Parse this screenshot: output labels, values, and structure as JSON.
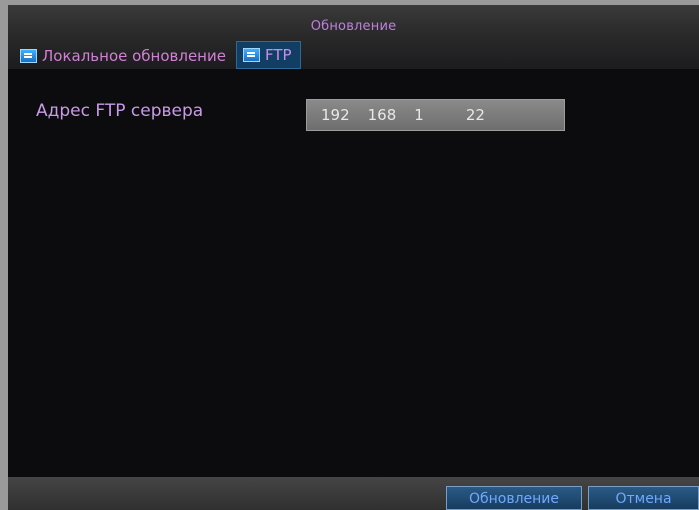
{
  "window": {
    "title": "Обновление"
  },
  "tabs": [
    {
      "label": "Локальное обновление",
      "icon": "tab-icon"
    },
    {
      "label": "FTP",
      "icon": "tab-icon"
    }
  ],
  "form": {
    "ftp_label": "Адрес FTP  сервера",
    "ip_octets": [
      "192",
      "168",
      "1",
      "22"
    ]
  },
  "footer": {
    "update_label": "Обновление",
    "cancel_label": "Отмена"
  },
  "colors": {
    "label_purple": "#c99ae8",
    "tab_active_bg": "#123e63",
    "button_text": "#6fa8ff"
  }
}
